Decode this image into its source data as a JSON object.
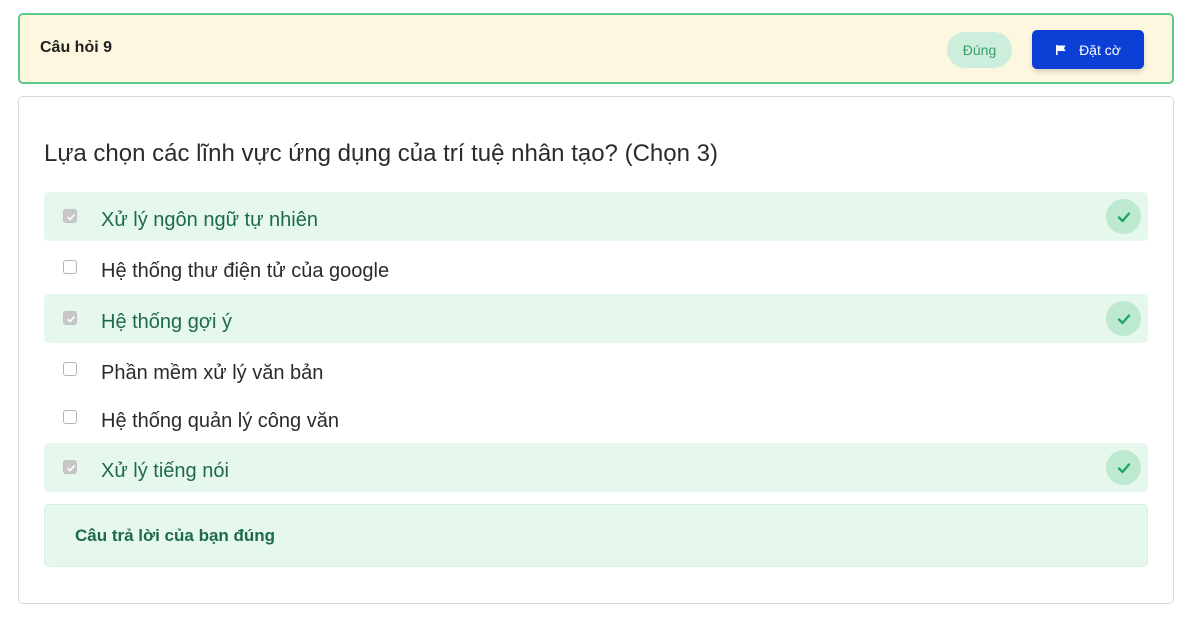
{
  "header": {
    "title": "Câu hỏi 9",
    "status_badge": "Đúng",
    "flag_button": "Đặt cờ"
  },
  "question": {
    "text": "Lựa chọn các lĩnh vực ứng dụng của trí tuệ nhân tạo? (Chọn 3)",
    "options": [
      {
        "label": "Xử lý ngôn ngữ tự nhiên",
        "checked": true,
        "correct": true
      },
      {
        "label": "Hệ thống thư điện tử của google",
        "checked": false,
        "correct": false
      },
      {
        "label": "Hệ thống gợi ý",
        "checked": true,
        "correct": true
      },
      {
        "label": "Phần mềm xử lý văn bản",
        "checked": false,
        "correct": false
      },
      {
        "label": "Hệ thống quản lý công văn",
        "checked": false,
        "correct": false
      },
      {
        "label": "Xử lý tiếng nói",
        "checked": true,
        "correct": true
      }
    ]
  },
  "feedback": {
    "text": "Câu trả lời của bạn đúng"
  },
  "icons": {
    "flag": "flag-icon",
    "correct": "check-circle-icon",
    "checkbox_checked": "checkbox-checked-icon"
  },
  "colors": {
    "header_bg": "#fef7e0",
    "header_border": "#5dc98a",
    "primary_button": "#0b3fd6",
    "correct_bg": "#e6f7ee",
    "correct_text": "#1d6b45",
    "check_mark": "#23a665"
  }
}
